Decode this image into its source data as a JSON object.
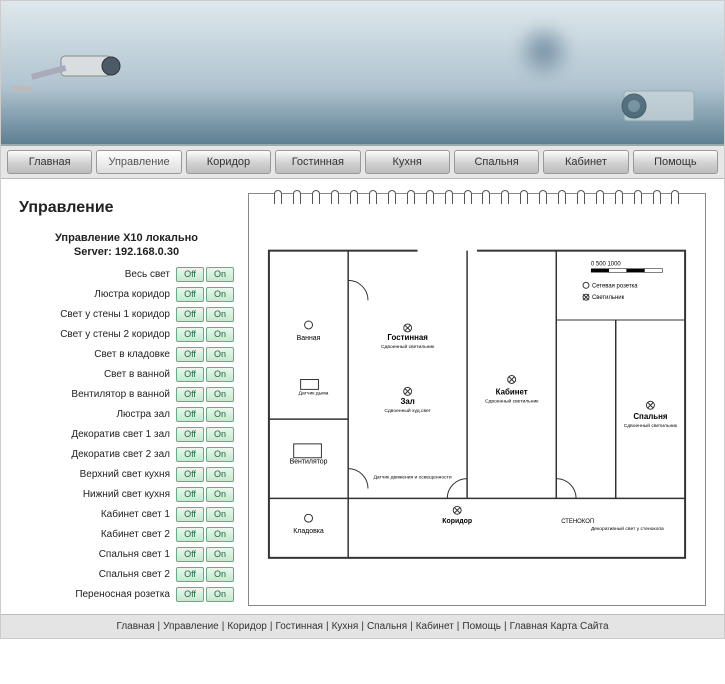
{
  "nav": {
    "tabs": [
      {
        "label": "Главная"
      },
      {
        "label": "Управление"
      },
      {
        "label": "Коридор"
      },
      {
        "label": "Гостинная"
      },
      {
        "label": "Кухня"
      },
      {
        "label": "Спальня"
      },
      {
        "label": "Кабинет"
      },
      {
        "label": "Помощь"
      }
    ],
    "active_index": 1
  },
  "page_title": "Управление",
  "panel": {
    "title_line1": "Управление X10 локально",
    "title_line2": "Server: 192.168.0.30",
    "off_label": "Off",
    "on_label": "On",
    "rows": [
      "Весь свет",
      "Люстра коридор",
      "Свет у стены 1 коридор",
      "Свет у стены 2 коридор",
      "Свет в кладовке",
      "Свет в ванной",
      "Вентилятор в ванной",
      "Люстра зал",
      "Декоратив свет 1 зал",
      "Декоратив свет 2 зал",
      "Верхний свет кухня",
      "Нижний свет кухня",
      "Кабинет свет 1",
      "Кабинет свет 2",
      "Спальня свет 1",
      "Спальня свет 2",
      "Переносная розетка"
    ]
  },
  "floorplan": {
    "legend_outlet": "Сетевая розетка",
    "legend_light": "Светильник",
    "scale_values": "0    500  1000",
    "rooms": {
      "gostinnaya": "Гостинная",
      "gostinnaya_sub": "Сдвоенный светильник",
      "zal": "Зал",
      "zal_sub": "Сдвоенный худ.свет",
      "kabinet": "Кабинет",
      "kabinet_sub": "Сдвоенный светильник",
      "spalnya": "Спальня",
      "spalnya_sub": "Сдвоенный светильник",
      "vannaya": "Ванная",
      "ventilyator": "Вентилятор",
      "kladovka": "Кладовка",
      "koridor": "Коридор",
      "datchik_dyma": "Датчик дыма",
      "datchik_dvizh": "Датчик движения и освещенности",
      "stenokop": "СТЕНОКОП",
      "dekor_svet": "Декоративный свет у стенокопа"
    }
  },
  "footer": {
    "links": [
      "Главная",
      "Управление",
      "Коридор",
      "Гостинная",
      "Кухня",
      "Спальня",
      "Кабинет",
      "Помощь",
      "Главная Карта Сайта"
    ]
  }
}
